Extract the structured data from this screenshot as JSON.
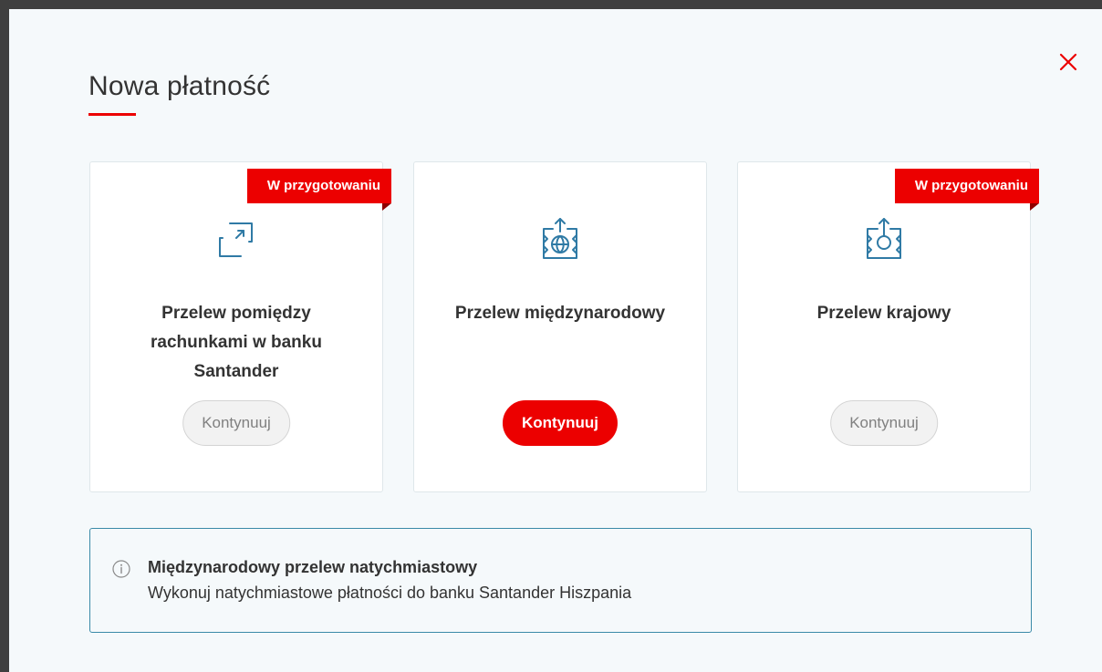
{
  "modal": {
    "title": "Nowa płatność",
    "close_icon": "close-icon",
    "accent_color": "#ec0000"
  },
  "cards": [
    {
      "badge": "W przygotowaniu",
      "icon": "transfer-between-accounts-icon",
      "title": "Przelew pomiędzy rachunkami w banku Santander",
      "button_label": "Kontynuuj",
      "button_state": "disabled"
    },
    {
      "badge": "",
      "icon": "international-transfer-globe-icon",
      "title": "Przelew międzynarodowy",
      "button_label": "Kontynuuj",
      "button_state": "enabled"
    },
    {
      "badge": "W przygotowaniu",
      "icon": "domestic-transfer-icon",
      "title": "Przelew krajowy",
      "button_label": "Kontynuuj",
      "button_state": "disabled"
    }
  ],
  "info": {
    "icon": "info-icon",
    "title": "Międzynarodowy przelew natychmiastowy",
    "text": "Wykonuj natychmiastowe płatności do banku Santander Hiszpania"
  }
}
